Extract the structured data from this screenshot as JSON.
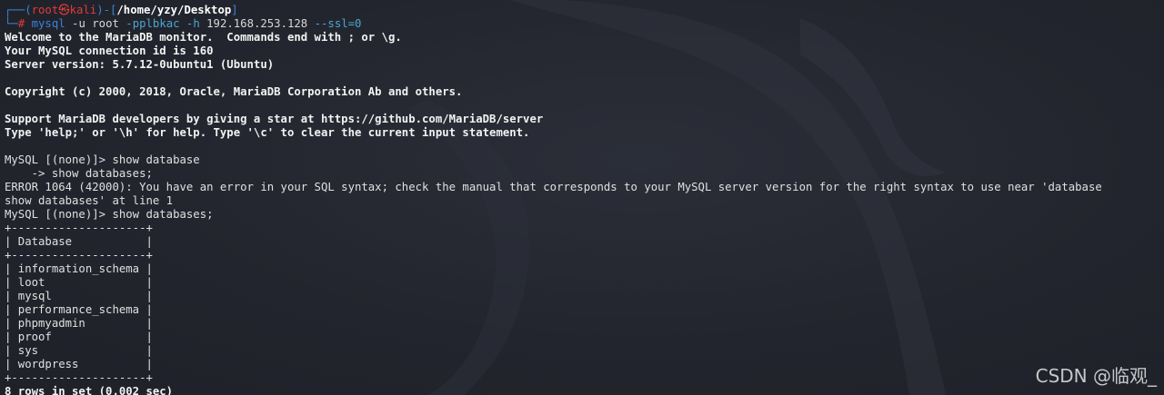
{
  "prompt": {
    "corner_top": "┌──",
    "user": "root",
    "at_symbol": "㉿",
    "host": "kali",
    "sep": ")-[",
    "path": "/home/yzy/Desktop",
    "close": "]",
    "corner_bottom": "└─",
    "hash": "#",
    "command": "mysql",
    "args1": " -u root ",
    "opt1": "-pplbkac",
    "opt2": " -h",
    "args2": " 192.168.253.128 ",
    "opt3": "--ssl=0"
  },
  "output": {
    "welcome": "Welcome to the MariaDB monitor.  Commands end with ; or \\g.",
    "conn_id": "Your MySQL connection id is 160",
    "server_version": "Server version: 5.7.12-0ubuntu1 (Ubuntu)",
    "copyright": "Copyright (c) 2000, 2018, Oracle, MariaDB Corporation Ab and others.",
    "support": "Support MariaDB developers by giving a star at https://github.com/MariaDB/server",
    "help": "Type 'help;' or '\\h' for help. Type '\\c' to clear the current input statement.",
    "query1": "MySQL [(none)]> show database",
    "query1_cont": "    -> show databases;",
    "error_line1": "ERROR 1064 (42000): You have an error in your SQL syntax; check the manual that corresponds to your MySQL server version for the right syntax to use near 'database",
    "error_line2": "show databases' at line 1",
    "query2": "MySQL [(none)]> show databases;",
    "table_border": "+--------------------+",
    "table_header": "| Database           |",
    "table_rows": [
      "| information_schema |",
      "| loot               |",
      "| mysql              |",
      "| performance_schema |",
      "| phpmyadmin         |",
      "| proof              |",
      "| sys                |",
      "| wordpress          |"
    ],
    "result": "8 rows in set (0.002 sec)"
  },
  "watermark": "CSDN @临观_",
  "colors": {
    "background": "#23252e",
    "prompt_blue": "#3b82d8",
    "prompt_red": "#e23a3a",
    "text": "#e6e6e6"
  }
}
